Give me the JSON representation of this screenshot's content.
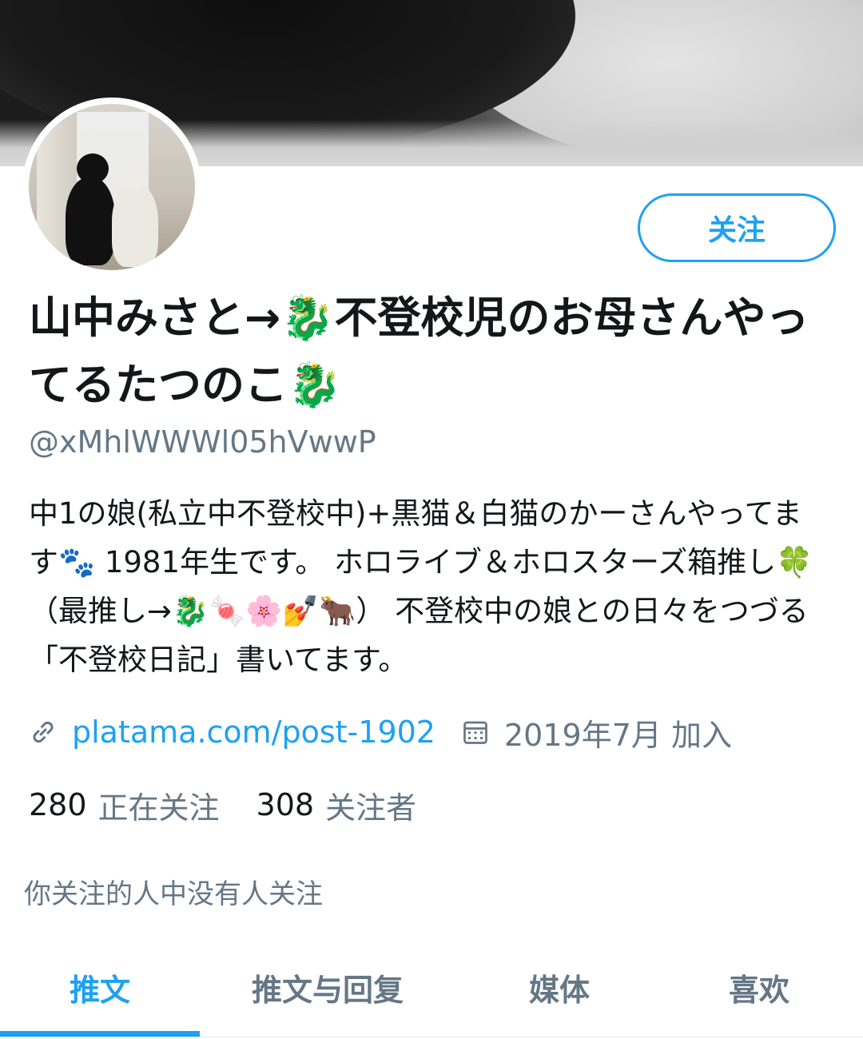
{
  "profile": {
    "display_name": "山中みさと→🐉不登校児のお母さんやってるたつのこ🐉",
    "handle": "@xMhlWWWl05hVwwP",
    "bio": "中1の娘(私立中不登校中)+黒猫＆白猫のかーさんやってます🐾 1981年生です。 ホロライブ＆ホロスターズ箱推し🍀 （最推し→🐉🍬🌸💅🐂） 不登校中の娘との日々をつづる「不登校日記」書いてます。",
    "website": "platama.com/post-1902",
    "joined": "2019年7月 加入",
    "follow_button_label": "关注"
  },
  "icons": {
    "link": "link-icon",
    "calendar": "calendar-icon"
  },
  "stats": {
    "following_count": "280",
    "following_label": "正在关注",
    "followers_count": "308",
    "followers_label": "关注者"
  },
  "mutual_note": "你关注的人中没有人关注",
  "tabs": [
    {
      "label": "推文",
      "active": true
    },
    {
      "label": "推文与回复",
      "active": false
    },
    {
      "label": "媒体",
      "active": false
    },
    {
      "label": "喜欢",
      "active": false
    }
  ],
  "colors": {
    "accent": "#1da1f2",
    "secondary_text": "#657786",
    "primary_text": "#14171a"
  }
}
